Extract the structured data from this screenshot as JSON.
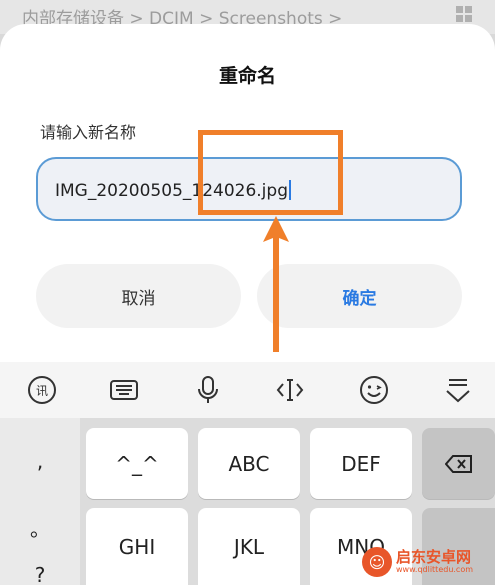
{
  "breadcrumb": {
    "text": "内部存储设备 > DCIM > Screenshots >"
  },
  "dialog": {
    "title": "重命名",
    "field_label": "请输入新名称",
    "input_value": "IMG_20200505_124026.jpg",
    "cancel_label": "取消",
    "confirm_label": "确定"
  },
  "annotation": {
    "color": "#f07f2a"
  },
  "keyboard": {
    "toolbar_icons": [
      "voice-recognition-icon",
      "keyboard-layout-icon",
      "microphone-icon",
      "cursor-move-icon",
      "emoji-icon",
      "collapse-keyboard-icon"
    ],
    "keys": {
      "comma": ",",
      "period": "。",
      "question": "?",
      "k1": "^_^",
      "k2": "ABC",
      "k3": "DEF",
      "k4": "GHI",
      "k5": "JKL",
      "k6": "MNO"
    }
  },
  "watermark": {
    "name": "启东安卓网",
    "url": "www.qdlittedu.com"
  },
  "colors": {
    "accent_blue": "#2a7ae2",
    "orange": "#f07f2a"
  }
}
